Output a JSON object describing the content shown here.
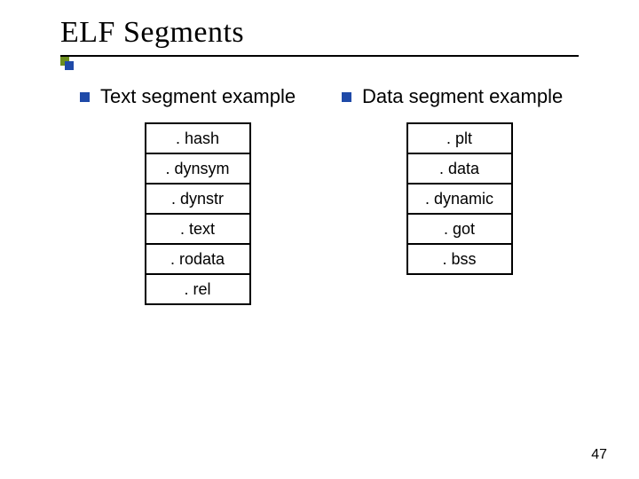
{
  "title": "ELF Segments",
  "left": {
    "heading": "Text segment example",
    "rows": [
      ". hash",
      ". dynsym",
      ". dynstr",
      ". text",
      ". rodata",
      ". rel"
    ]
  },
  "right": {
    "heading": "Data segment example",
    "rows": [
      ". plt",
      ". data",
      ". dynamic",
      ". got",
      ". bss"
    ]
  },
  "page_number": "47"
}
